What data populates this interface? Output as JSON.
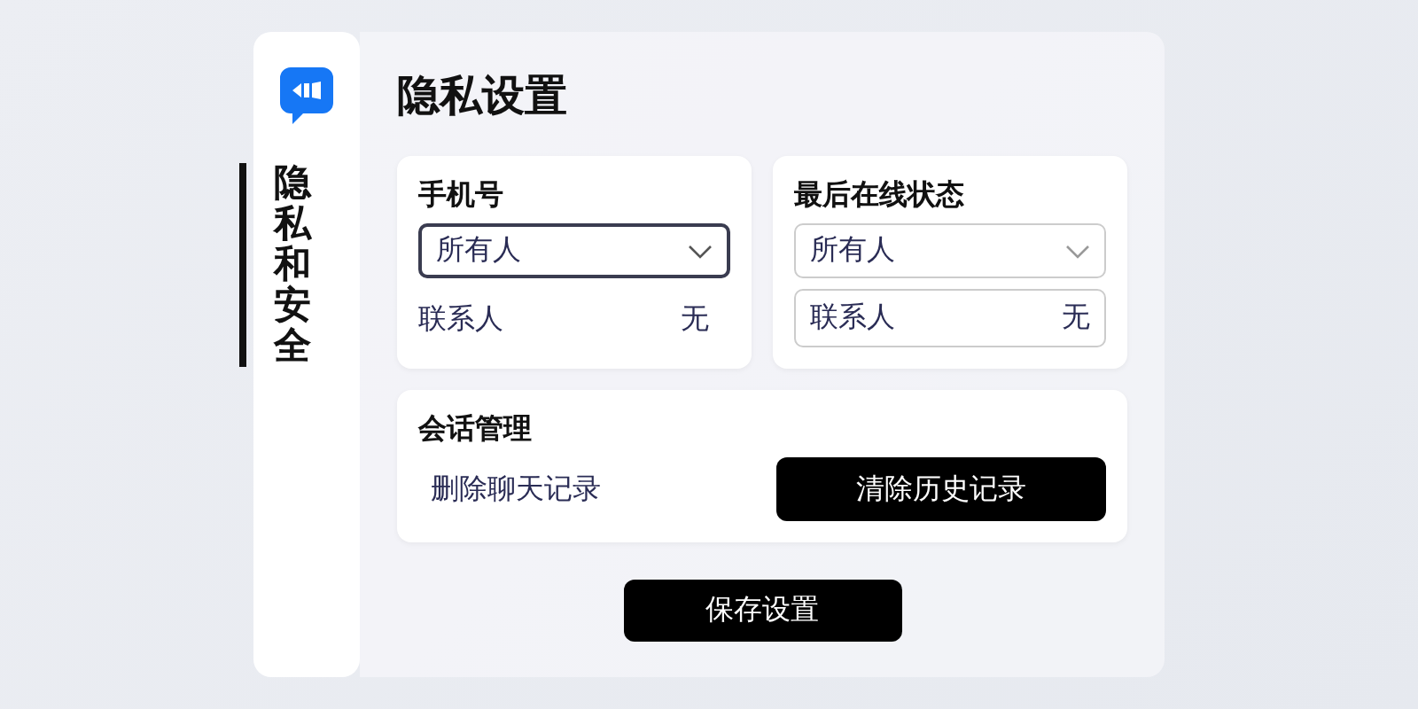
{
  "sidebar": {
    "items": [
      {
        "label": "隐私和安全",
        "selected": true
      }
    ]
  },
  "title": "隐私设置",
  "cards": [
    {
      "title": "手机号",
      "dropdown": {
        "value": "所有人",
        "focused": true
      },
      "row": {
        "kind": "plain",
        "label": "联系人",
        "value": "无"
      }
    },
    {
      "title": "最后在线状态",
      "dropdown": {
        "value": "所有人",
        "focused": false
      },
      "row": {
        "kind": "field",
        "label": "联系人",
        "value": "无"
      }
    }
  ],
  "session": {
    "title": "会话管理",
    "link": "删除聊天记录",
    "button": "清除历史记录"
  },
  "save_button": "保存设置"
}
